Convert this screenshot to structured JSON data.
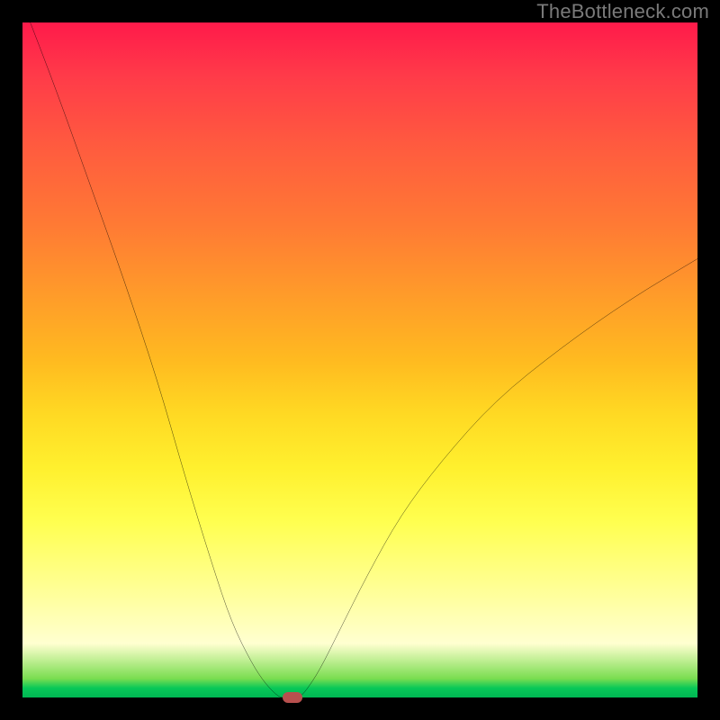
{
  "watermark": "TheBottleneck.com",
  "chart_data": {
    "type": "line",
    "title": "",
    "xlabel": "",
    "ylabel": "",
    "xlim": [
      0,
      100
    ],
    "ylim": [
      0,
      100
    ],
    "series": [
      {
        "name": "bottleneck-curve",
        "x": [
          0,
          5,
          10,
          15,
          20,
          24,
          28,
          31,
          34,
          36,
          38,
          39,
          40,
          41,
          42,
          44,
          47,
          51,
          56,
          62,
          70,
          80,
          90,
          100
        ],
        "values": [
          103,
          90,
          76,
          62,
          47,
          33,
          20,
          11,
          5,
          2,
          0,
          0,
          0,
          0,
          1,
          4,
          10,
          18,
          27,
          35,
          44,
          52,
          59,
          65
        ]
      }
    ],
    "marker": {
      "x": 40,
      "y": 0,
      "color": "#b8504e"
    },
    "gradient_bands": [
      {
        "color": "#ff1a4a",
        "stop": 0
      },
      {
        "color": "#fff02e",
        "stop": 66
      },
      {
        "color": "#00b753",
        "stop": 100
      }
    ]
  }
}
